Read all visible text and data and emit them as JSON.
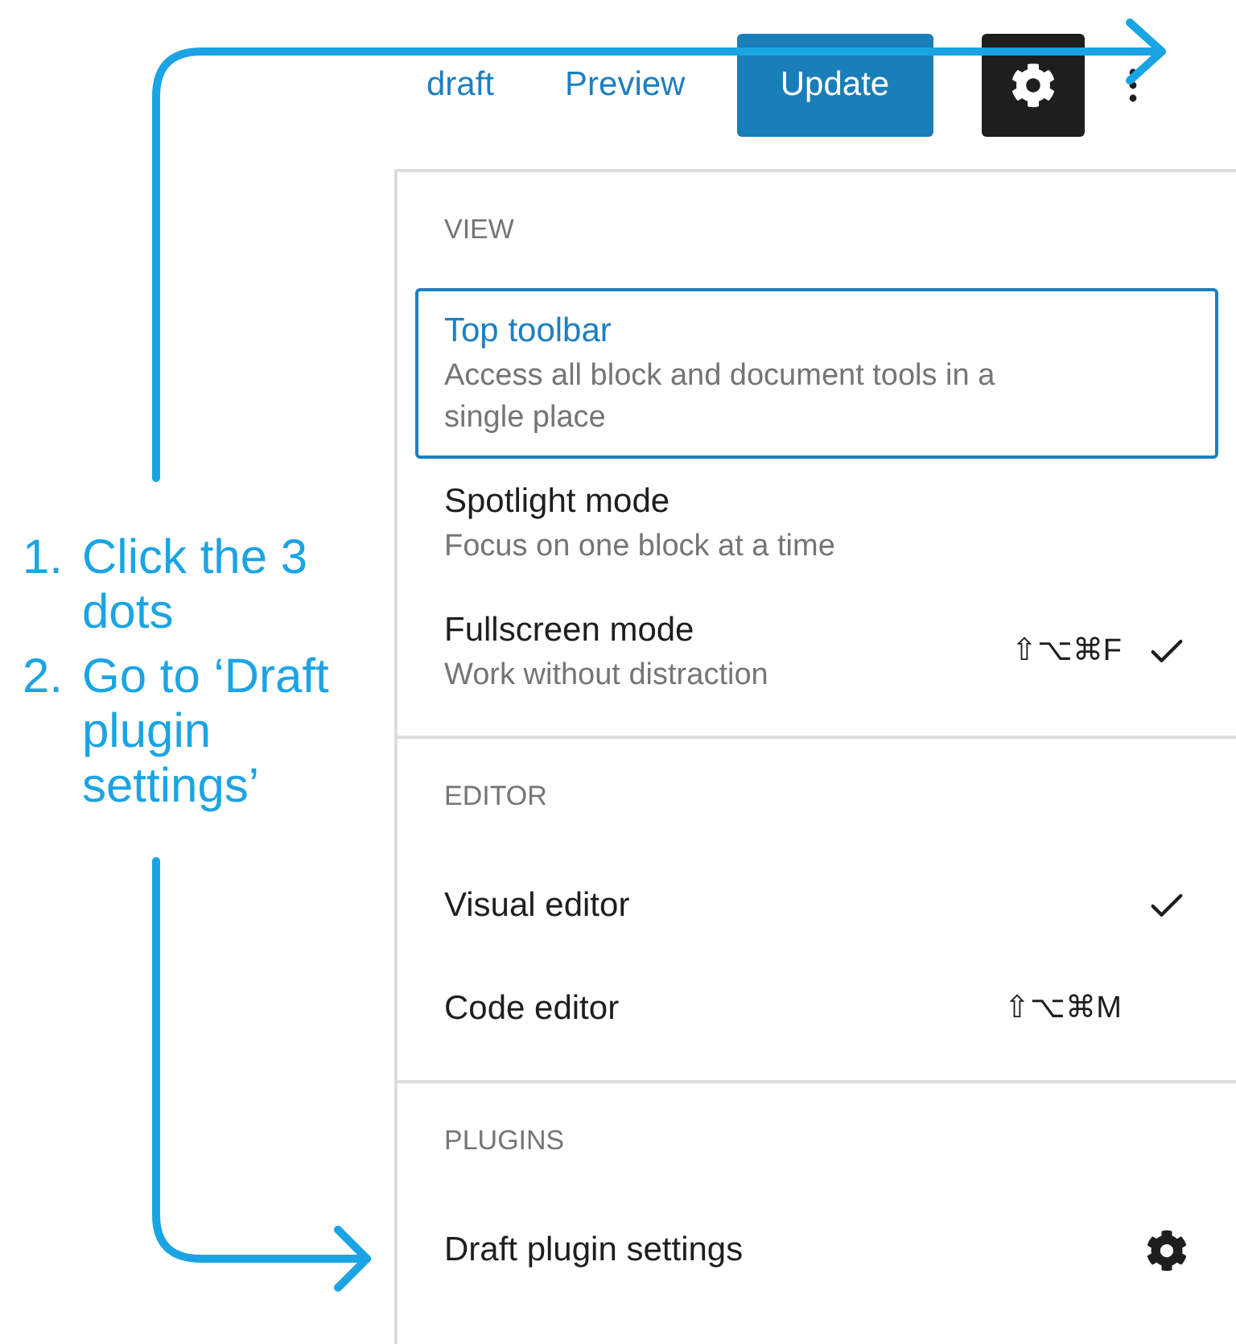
{
  "toolbar": {
    "save_draft": "draft",
    "preview": "Preview",
    "update": "Update"
  },
  "annotation": {
    "steps": [
      {
        "number": "1.",
        "text": "Click the 3 dots"
      },
      {
        "number": "2.",
        "text": "Go to ‘Draft plugin settings’"
      }
    ]
  },
  "menu": {
    "sections": [
      {
        "heading": "VIEW",
        "items": [
          {
            "kind": "option",
            "label": "Top toolbar",
            "description": "Access all block and document tools in a single place",
            "selected": true,
            "checked": false
          },
          {
            "kind": "option",
            "label": "Spotlight mode",
            "description": "Focus on one block at a time",
            "selected": false,
            "checked": false
          },
          {
            "kind": "option",
            "label": "Fullscreen mode",
            "description": "Work without distraction",
            "shortcut": "⇧⌥⌘F",
            "selected": false,
            "checked": true
          }
        ]
      },
      {
        "heading": "EDITOR",
        "items": [
          {
            "kind": "option",
            "label": "Visual editor",
            "selected": false,
            "checked": true
          },
          {
            "kind": "option",
            "label": "Code editor",
            "shortcut": "⇧⌥⌘M",
            "selected": false,
            "checked": false
          }
        ]
      },
      {
        "heading": "PLUGINS",
        "items": [
          {
            "kind": "plugin",
            "label": "Draft plugin settings",
            "selected": false,
            "checked": false
          }
        ]
      }
    ]
  }
}
